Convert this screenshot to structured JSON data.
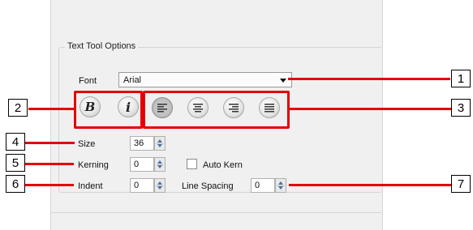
{
  "group": {
    "title": "Text Tool Options"
  },
  "font": {
    "label": "Font",
    "value": "Arial"
  },
  "style_buttons": {
    "bold": "B",
    "italic": "i"
  },
  "alignment": [
    "align-left",
    "align-center",
    "align-right",
    "justify"
  ],
  "size": {
    "label": "Size",
    "value": "36"
  },
  "kerning": {
    "label": "Kerning",
    "value": "0"
  },
  "auto_kern": {
    "label": "Auto Kern",
    "checked": false
  },
  "indent": {
    "label": "Indent",
    "value": "0"
  },
  "line_spacing": {
    "label": "Line Spacing",
    "value": "0"
  },
  "callouts": [
    "1",
    "2",
    "3",
    "4",
    "5",
    "6",
    "7"
  ],
  "colors": {
    "highlight": "#e40000",
    "panel": "#f0f0f0",
    "spin_arrow": "#4a6fa5"
  }
}
